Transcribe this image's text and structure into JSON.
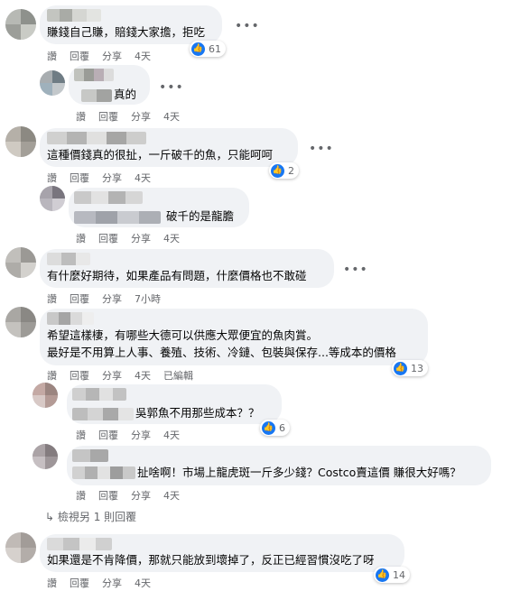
{
  "icons": {
    "like": "thumbs-up-icon",
    "more": "more-options-icon",
    "reply_arrow": "reply-arrow-icon"
  },
  "colors": {
    "like_blue": "#1877f2",
    "bubble": "#f0f2f5",
    "meta_gray": "#65676b"
  },
  "actions": {
    "like": "讚",
    "reply": "回覆",
    "share": "分享"
  },
  "comments": [
    {
      "text": "賺錢自己賺，賠錢大家擔，拒吃",
      "time": "4天",
      "reactions": "61"
    },
    {
      "text": "真的",
      "time": "4天"
    },
    {
      "text": "這種價錢真的很扯，一斤破千的魚，只能呵呵",
      "time": "4天",
      "reactions": "2"
    },
    {
      "text": "破千的是龍膽",
      "time": "4天"
    },
    {
      "text": "有什麼好期待，如果產品有問題，什麼價格也不敢碰",
      "time": "7小時"
    },
    {
      "line1": "希望這樣棲，有哪些大德可以供應大眾便宜的魚肉賞。",
      "line2": "最好是不用算上人事、養殖、技術、冷鏈、包裝與保存...等成本的價格",
      "time": "4天",
      "edited": "已編輯",
      "reactions": "13"
    },
    {
      "text": "吳郭魚不用那些成本？？",
      "time": "4天",
      "reactions": "6"
    },
    {
      "text": "扯啥啊！市場上龍虎斑一斤多少錢？Costco賣這價 賺很大好嗎？",
      "time": "4天"
    },
    {
      "text": "如果還是不肯降價，那就只能放到壞掉了，反正已經習慣沒吃了呀",
      "time": "4天",
      "reactions": "14"
    }
  ],
  "more_replies": "檢視另 1 則回覆"
}
